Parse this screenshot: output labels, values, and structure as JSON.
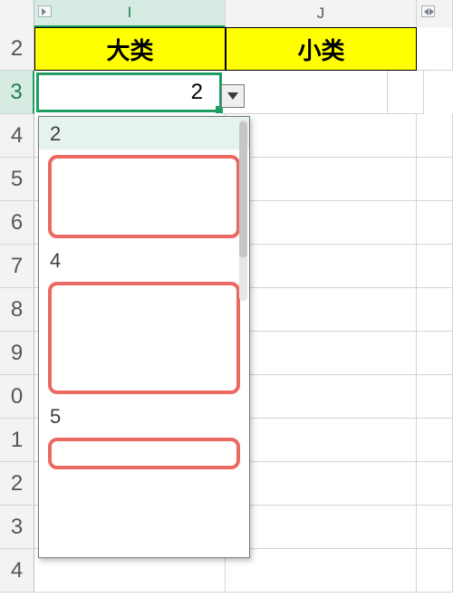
{
  "columns": {
    "I": "I",
    "J": "J"
  },
  "row_numbers": [
    "2",
    "3",
    "4",
    "5",
    "6",
    "7",
    "8",
    "9",
    "0",
    "1",
    "2",
    "3",
    "4"
  ],
  "headers": {
    "I": "大类",
    "J": "小类"
  },
  "active_cell": {
    "value": "2"
  },
  "dropdown": {
    "items": [
      {
        "label": "2",
        "highlight": true
      },
      {
        "label": "4",
        "highlight": false
      },
      {
        "label": "5",
        "highlight": false
      }
    ]
  }
}
